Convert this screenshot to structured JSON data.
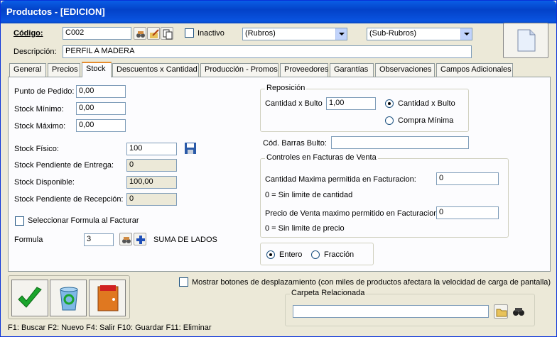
{
  "window": {
    "title": "Productos - [EDICION]"
  },
  "header": {
    "codigo_label": "Código:",
    "codigo_value": "C002",
    "inactivo_label": "Inactivo",
    "rubros_value": "(Rubros)",
    "subrubros_value": "(Sub-Rubros)",
    "descripcion_label": "Descripción:",
    "descripcion_value": "PERFIL A MADERA"
  },
  "tabs": [
    "General",
    "Precios",
    "Stock",
    "Descuentos x Cantidad",
    "Producción - Promos",
    "Proveedores",
    "Garantías",
    "Observaciones",
    "Campos Adicionales"
  ],
  "stock": {
    "punto_pedido_label": "Punto de Pedido:",
    "punto_pedido_value": "0,00",
    "stock_minimo_label": "Stock Mínimo:",
    "stock_minimo_value": "0,00",
    "stock_maximo_label": "Stock Máximo:",
    "stock_maximo_value": "0,00",
    "stock_fisico_label": "Stock Físico:",
    "stock_fisico_value": "100",
    "pend_entrega_label": "Stock Pendiente de Entrega:",
    "pend_entrega_value": "0",
    "disponible_label": "Stock Disponible:",
    "disponible_value": "100,00",
    "pend_recepcion_label": "Stock Pendiente de Recepción:",
    "pend_recepcion_value": "0",
    "sel_formula_label": "Seleccionar Formula al Facturar",
    "formula_label": "Formula",
    "formula_value": "3",
    "formula_desc": "SUMA DE LADOS"
  },
  "reposicion": {
    "title": "Reposición",
    "cant_bulto_label": "Cantidad x Bulto",
    "cant_bulto_value": "1,00",
    "opt_cant_bulto": "Cantidad x Bulto",
    "opt_compra_minima": "Compra Mínima"
  },
  "barras": {
    "label": "Cód. Barras Bulto:",
    "value": ""
  },
  "controles": {
    "title": "Controles en Facturas de Venta",
    "cant_max_label": "Cantidad Maxima permitida en Facturacion:",
    "cant_max_value": "0",
    "cant_note": "0 = Sin limite de cantidad",
    "precio_max_label": "Precio de Venta maximo permitido en Facturacion:",
    "precio_max_value": "0",
    "precio_note": "0 = Sin limite de precio"
  },
  "tipo": {
    "entero": "Entero",
    "fraccion": "Fracción"
  },
  "footer": {
    "mostrar_label": "Mostrar botones de desplazamiento  (con miles de productos afectara la velocidad de carga de pantalla)",
    "carpeta_title": "Carpeta Relacionada",
    "carpeta_value": "",
    "shortcuts": "F1: Buscar  F2: Nuevo  F4: Salir  F10: Guardar  F11: Eliminar"
  },
  "colors": {
    "titlebar": "#0342c8",
    "face": "#ece9d8",
    "tab_accent": "#e68b2c"
  }
}
